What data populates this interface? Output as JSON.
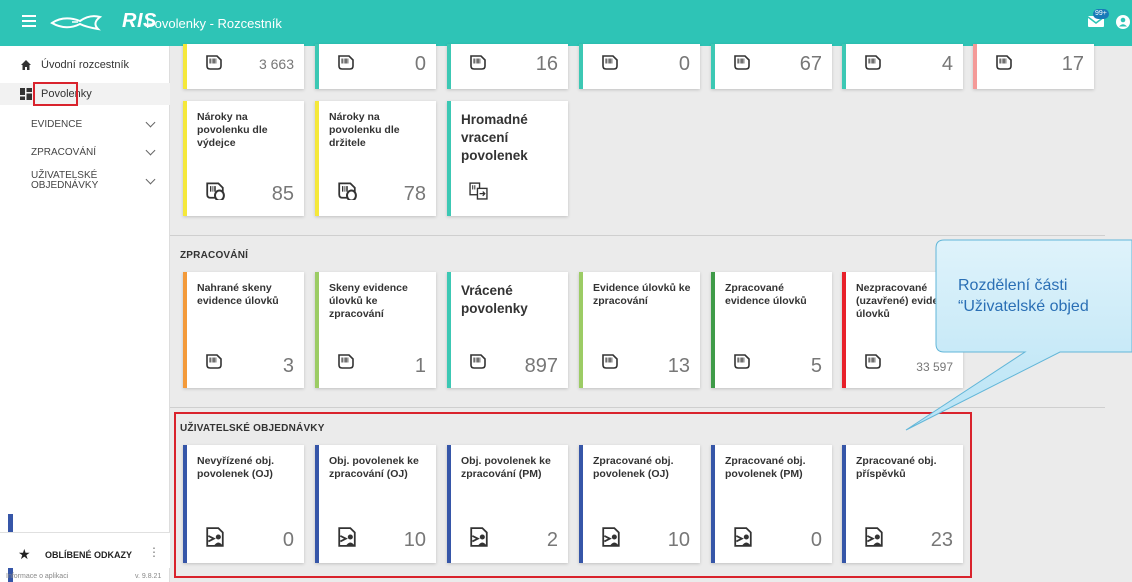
{
  "header": {
    "logo_text": "RIS",
    "app_title": "Povolenky - Rozcestník",
    "notification_badge": "99+"
  },
  "sidebar": {
    "items": [
      {
        "label": "Úvodní rozcestník"
      },
      {
        "label": "Povolenky"
      }
    ],
    "groups": [
      {
        "label": "EVIDENCE"
      },
      {
        "label": "ZPRACOVÁNÍ"
      },
      {
        "label_line1": "UŽIVATELSKÉ",
        "label_line2": "OBJEDNÁVKY"
      }
    ],
    "favorites_label": "OBLÍBENÉ ODKAZY",
    "footer_left": "Informace o aplikaci",
    "footer_right": "v. 9.8.21"
  },
  "top_row": {
    "values": [
      "3 663",
      "0",
      "16",
      "0",
      "67",
      "4",
      "17"
    ]
  },
  "evidence_row": [
    {
      "title": "Nároky na povolenku dle výdejce",
      "value": "85"
    },
    {
      "title": "Nároky na povolenku dle držitele",
      "value": "78"
    },
    {
      "title": "Hromadné vracení povolenek",
      "value": ""
    }
  ],
  "zpracovani": {
    "section_title": "ZPRACOVÁNÍ",
    "cards": [
      {
        "title": "Nahrané skeny evidence úlovků",
        "value": "3"
      },
      {
        "title": "Skeny evidence úlovků ke zpracování",
        "value": "1"
      },
      {
        "title": "Vrácené povolenky",
        "value": "897"
      },
      {
        "title": "Evidence úlovků ke zpracování",
        "value": "13"
      },
      {
        "title": "Zpracované evidence úlovků",
        "value": "5"
      },
      {
        "title": "Nezpracované (uzavřené) evide úlovků",
        "value": "33 597"
      }
    ]
  },
  "objednavky": {
    "section_title": "UŽIVATELSKÉ OBJEDNÁVKY",
    "cards": [
      {
        "title": "Nevyřízené obj. povolenek (OJ)",
        "value": "0"
      },
      {
        "title": "Obj. povolenek ke zpracování (OJ)",
        "value": "10"
      },
      {
        "title": "Obj. povolenek ke zpracování (PM)",
        "value": "2"
      },
      {
        "title": "Zpracované obj. povolenek (OJ)",
        "value": "10"
      },
      {
        "title": "Zpracované obj. povolenek (PM)",
        "value": "0"
      },
      {
        "title": "Zpracované obj. příspěvků",
        "value": "23"
      }
    ]
  },
  "callout": {
    "line1": "Rozdělení části",
    "line2": "“Uživatelské objed"
  },
  "colors": {
    "brand": "#2ec4b6",
    "highlight_red": "#d9232d",
    "teal_border": "#3cc8b4",
    "yellow_border": "#f5e83a",
    "orange_border": "#f39a3a",
    "lightgreen_border": "#9ccc65",
    "green_border": "#3f9b48",
    "red_border": "#e8202a",
    "blue_border": "#3656a8",
    "pink_border": "#f49a98"
  }
}
